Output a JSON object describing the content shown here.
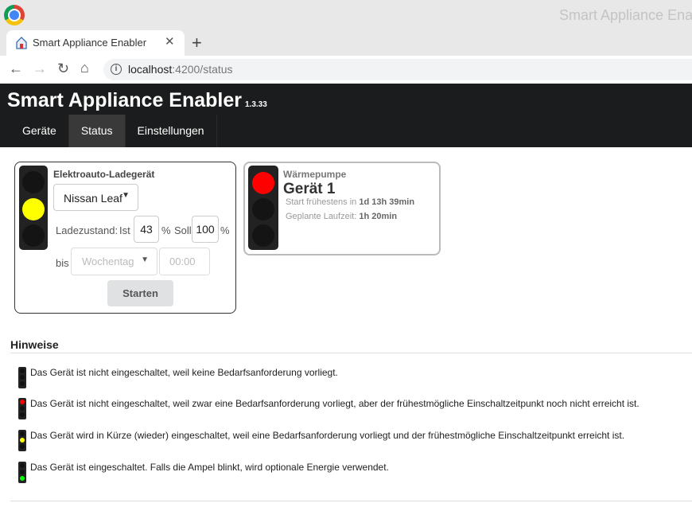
{
  "browser": {
    "window_title": "Smart Appliance Enabler",
    "tab_title": "Smart Appliance Enabler",
    "url_host": "localhost",
    "url_rest": ":4200/status"
  },
  "app": {
    "brand": "Smart Appliance Enabler",
    "version": "1.3.33",
    "menu": [
      {
        "label": "Geräte",
        "active": false
      },
      {
        "label": "Status",
        "active": true
      },
      {
        "label": "Einstellungen",
        "active": false
      }
    ]
  },
  "device1": {
    "type": "Elektroauto-Ladegerät",
    "light_state": "yellow",
    "vehicle": "Nissan Leaf",
    "charge_label": "Ladezustand:",
    "ist_label": "Ist",
    "ist_value": "43",
    "percent": "%",
    "soll_label": "Soll",
    "soll_value": "100",
    "bis_label": "bis",
    "day_placeholder": "Wochentag",
    "time_placeholder": "00:00",
    "start_button": "Starten"
  },
  "device2": {
    "type": "Wärmepumpe",
    "name": "Gerät 1",
    "light_state": "red",
    "start_label": "Start frühestens in",
    "start_value": "1d 13h 39min",
    "runtime_label": "Geplante Laufzeit:",
    "runtime_value": "1h 20min"
  },
  "hints": {
    "title": "Hinweise",
    "items": [
      {
        "light": "off",
        "text": "Das Gerät ist nicht eingeschaltet, weil keine Bedarfsanforderung vorliegt."
      },
      {
        "light": "red",
        "text": "Das Gerät ist nicht eingeschaltet, weil zwar eine Bedarfsanforderung vorliegt, aber der frühestmögliche Einschaltzeitpunkt noch nicht erreicht ist."
      },
      {
        "light": "yellow",
        "text": "Das Gerät wird in Kürze (wieder) eingeschaltet, weil eine Bedarfsanforderung vorliegt und der frühestmögliche Einschaltzeitpunkt erreicht ist."
      },
      {
        "light": "green",
        "text": "Das Gerät ist eingeschaltet. Falls die Ampel blinkt, wird optionale Energie verwendet."
      }
    ]
  },
  "colors": {
    "navbar": "#1b1c1d",
    "lamp_red": "#ff0000",
    "lamp_yellow": "#ffff00",
    "lamp_green": "#00ff00"
  }
}
